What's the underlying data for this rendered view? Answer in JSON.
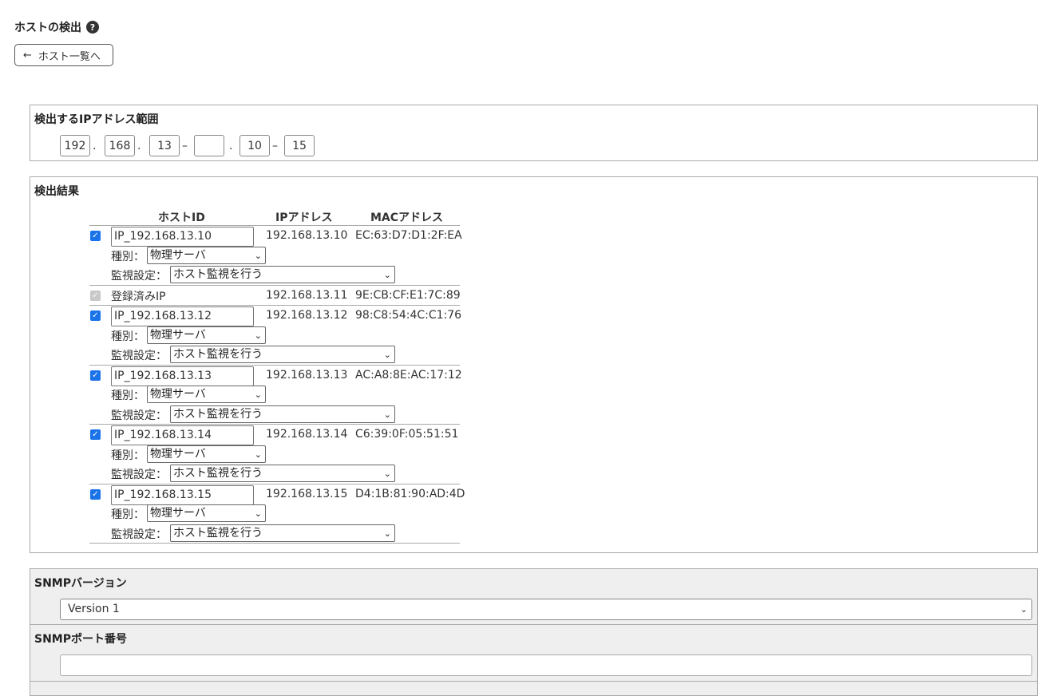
{
  "page": {
    "title": "ホストの検出",
    "help_icon": "?",
    "back_button": "ホスト一覧へ",
    "back_arrow": "←"
  },
  "ip_range": {
    "label": "検出するIPアドレス範囲",
    "octet1": "192",
    "octet2": "168",
    "octet3_from": "13",
    "octet3_to": "",
    "octet4_from": "10",
    "octet4_to": "15",
    "dot": ".",
    "dash": "–"
  },
  "results": {
    "label": "検出結果",
    "headers": {
      "host_id": "ホストID",
      "ip": "IPアドレス",
      "mac": "MACアドレス"
    },
    "type_label": "種別：",
    "monitor_label": "監視設定：",
    "type_value": "物理サーバ",
    "monitor_value": "ホスト監視を行う",
    "registered_label": "登録済みIP",
    "hosts": [
      {
        "id": "IP_192.168.13.10",
        "ip": "192.168.13.10",
        "mac": "EC:63:D7:D1:2F:EA"
      },
      {
        "id": "",
        "ip": "192.168.13.11",
        "mac": "9E:CB:CF:E1:7C:89"
      },
      {
        "id": "IP_192.168.13.12",
        "ip": "192.168.13.12",
        "mac": "98:C8:54:4C:C1:76"
      },
      {
        "id": "IP_192.168.13.13",
        "ip": "192.168.13.13",
        "mac": "AC:A8:8E:AC:17:12"
      },
      {
        "id": "IP_192.168.13.14",
        "ip": "192.168.13.14",
        "mac": "C6:39:0F:05:51:51"
      },
      {
        "id": "IP_192.168.13.15",
        "ip": "192.168.13.15",
        "mac": "D4:1B:81:90:AD:4D"
      }
    ]
  },
  "snmp": {
    "version_label": "SNMPバージョン",
    "version_value": "Version 1",
    "port_label": "SNMPポート番号",
    "port_value": ""
  },
  "icons": {
    "check": "✓",
    "chevron": "⌄"
  }
}
